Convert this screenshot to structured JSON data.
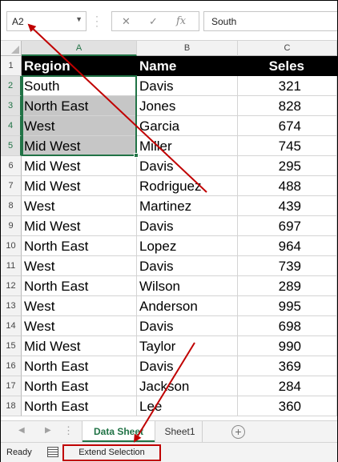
{
  "formula_bar": {
    "name_box": "A2",
    "cancel_icon": "✕",
    "enter_icon": "✓",
    "fx_label": "fx",
    "value": "South"
  },
  "columns": [
    "A",
    "B",
    "C"
  ],
  "rows": [
    {
      "num": "1",
      "region": "Region",
      "name": "Name",
      "sales": "Seles"
    },
    {
      "num": "2",
      "region": "South",
      "name": "Davis",
      "sales": "321"
    },
    {
      "num": "3",
      "region": "North East",
      "name": "Jones",
      "sales": "828"
    },
    {
      "num": "4",
      "region": "West",
      "name": "Garcia",
      "sales": "674"
    },
    {
      "num": "5",
      "region": "Mid West",
      "name": "Miller",
      "sales": "745"
    },
    {
      "num": "6",
      "region": "Mid West",
      "name": "Davis",
      "sales": "295"
    },
    {
      "num": "7",
      "region": "Mid West",
      "name": "Rodriguez",
      "sales": "488"
    },
    {
      "num": "8",
      "region": "West",
      "name": "Martinez",
      "sales": "439"
    },
    {
      "num": "9",
      "region": "Mid West",
      "name": "Davis",
      "sales": "697"
    },
    {
      "num": "10",
      "region": "North East",
      "name": "Lopez",
      "sales": "964"
    },
    {
      "num": "11",
      "region": "West",
      "name": "Davis",
      "sales": "739"
    },
    {
      "num": "12",
      "region": "North East",
      "name": "Wilson",
      "sales": "289"
    },
    {
      "num": "13",
      "region": "West",
      "name": "Anderson",
      "sales": "995"
    },
    {
      "num": "14",
      "region": "West",
      "name": "Davis",
      "sales": "698"
    },
    {
      "num": "15",
      "region": "Mid West",
      "name": "Taylor",
      "sales": "990"
    },
    {
      "num": "16",
      "region": "North East",
      "name": "Davis",
      "sales": "369"
    },
    {
      "num": "17",
      "region": "North East",
      "name": "Jackson",
      "sales": "284"
    },
    {
      "num": "18",
      "region": "North East",
      "name": "Lee",
      "sales": "360"
    }
  ],
  "sheet_tabs": {
    "active": "Data Sheet",
    "other": "Sheet1",
    "add_icon": "+"
  },
  "status_bar": {
    "ready": "Ready",
    "mode": "Extend Selection"
  },
  "colors": {
    "accent": "#217346",
    "annotation": "#c00000",
    "selection": "#c6c6c6"
  }
}
